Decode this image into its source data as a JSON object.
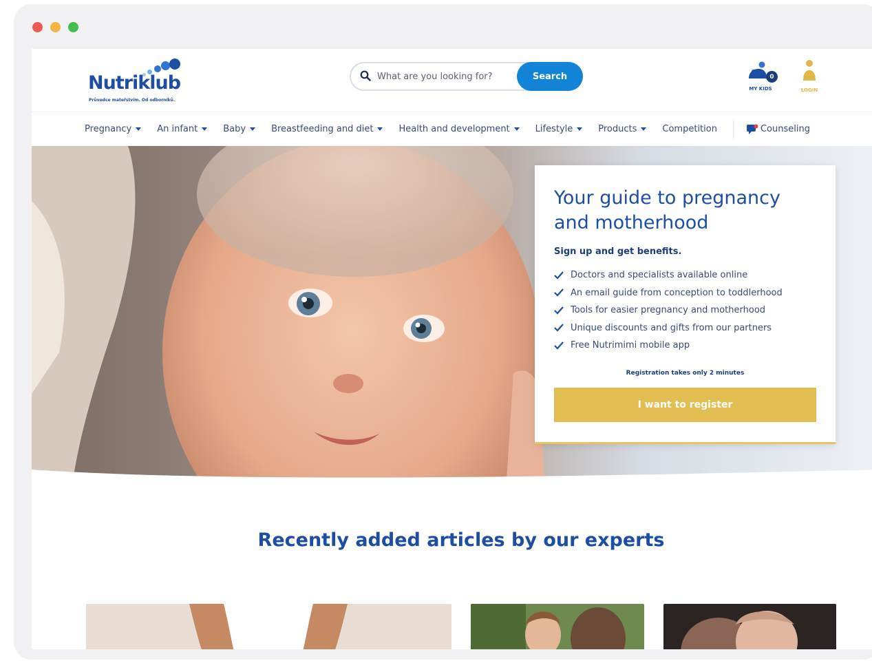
{
  "window": {
    "traffic_lights": [
      "close",
      "minimize",
      "maximize"
    ]
  },
  "header": {
    "logo": {
      "name": "Nutriklub",
      "tagline": "Průvodce mateřstvím. Od odborníků."
    },
    "search": {
      "placeholder": "What are you looking for?",
      "button_label": "Search"
    },
    "my_kids": {
      "label": "MY KIDS",
      "count": "0"
    },
    "login": {
      "label": "LOGIN"
    }
  },
  "nav": {
    "items": [
      {
        "label": "Pregnancy",
        "has_dropdown": true
      },
      {
        "label": "An infant",
        "has_dropdown": true
      },
      {
        "label": "Baby",
        "has_dropdown": true
      },
      {
        "label": "Breastfeeding and diet",
        "has_dropdown": true
      },
      {
        "label": "Health and development",
        "has_dropdown": true
      },
      {
        "label": "Lifestyle",
        "has_dropdown": true
      },
      {
        "label": "Products",
        "has_dropdown": true
      },
      {
        "label": "Competition",
        "has_dropdown": false
      }
    ],
    "counseling": {
      "label": "Counseling",
      "icon": "chat-icon"
    }
  },
  "hero": {
    "title": "Your guide to pregnancy and motherhood",
    "subtitle": "Sign up and get benefits.",
    "benefits": [
      "Doctors and specialists available online",
      "An email guide from conception to toddlerhood",
      "Tools for easier pregnancy and motherhood",
      "Unique discounts and gifts from our partners",
      "Free Nutrimimi mobile app"
    ],
    "registration_note": "Registration takes only 2 minutes",
    "cta_label": "I want to register"
  },
  "articles": {
    "section_title": "Recently added articles by our experts"
  },
  "colors": {
    "brand_blue": "#1d4ea3",
    "search_blue": "#1284d7",
    "cta_gold": "#e2bd52"
  }
}
